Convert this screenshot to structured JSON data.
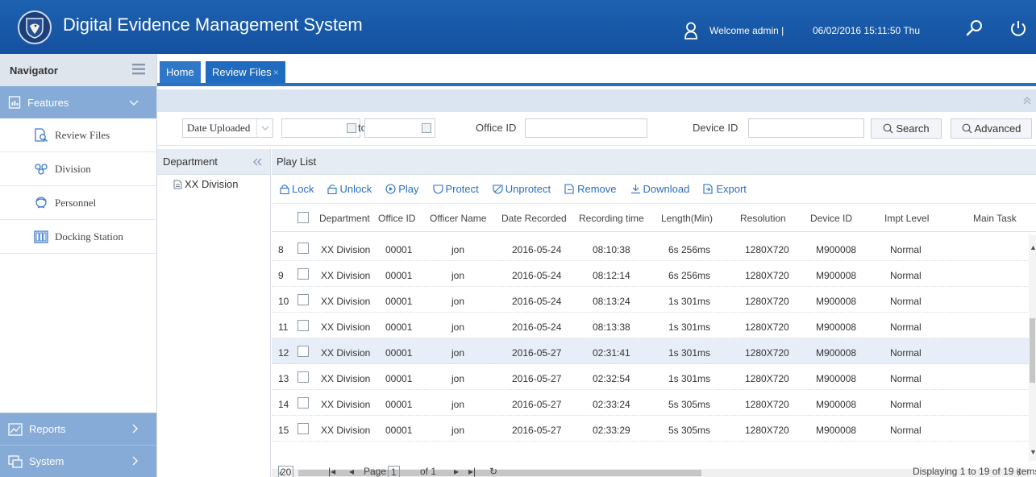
{
  "header": {
    "title": "Digital Evidence Management System",
    "welcome": "Welcome  admin |",
    "datetime": "06/02/2016 15:11:50 Thu",
    "logo_icon": "eagle-shield-icon",
    "user_icon": "user-icon",
    "search_icon": "search-icon",
    "power_icon": "power-icon"
  },
  "sidebar": {
    "navigator": "Navigator",
    "groups": [
      {
        "label": "Features",
        "icon": "features-icon"
      },
      {
        "label": "Reports",
        "icon": "reports-icon"
      },
      {
        "label": "System",
        "icon": "system-icon"
      }
    ],
    "items": [
      {
        "label": "Review Files",
        "icon": "review-files-icon"
      },
      {
        "label": "Division",
        "icon": "division-icon"
      },
      {
        "label": "Personnel",
        "icon": "personnel-icon"
      },
      {
        "label": "Docking Station",
        "icon": "docking-station-icon"
      }
    ]
  },
  "tabs": [
    {
      "label": "Home"
    },
    {
      "label": "Review Files",
      "close": "×"
    }
  ],
  "filter": {
    "date_select": "Date Uploaded",
    "to_label": "to",
    "office_id_label": "Office ID",
    "device_id_label": "Device ID",
    "search_button": "Search",
    "advanced_button": "Advanced"
  },
  "department": {
    "title": "Department",
    "node": "XX Division"
  },
  "playlist": {
    "title": "Play List",
    "toolbar": [
      "Lock",
      "Unlock",
      "Play",
      "Protect",
      "Unprotect",
      "Remove",
      "Download",
      "Export"
    ],
    "columns": [
      "Department",
      "Office ID",
      "Officer Name",
      "Date Recorded",
      "Recording time",
      "Length(Min)",
      "Resolution",
      "Device ID",
      "Impt Level",
      "Main Task"
    ],
    "rows": [
      {
        "n": "8",
        "dept": "XX Division",
        "office": "00001",
        "officer": "jon",
        "date": "2016-05-24",
        "time": "08:10:38",
        "length": "6s 256ms",
        "res": "1280X720",
        "device": "M900008",
        "level": "Normal"
      },
      {
        "n": "9",
        "dept": "XX Division",
        "office": "00001",
        "officer": "jon",
        "date": "2016-05-24",
        "time": "08:12:14",
        "length": "6s 256ms",
        "res": "1280X720",
        "device": "M900008",
        "level": "Normal"
      },
      {
        "n": "10",
        "dept": "XX Division",
        "office": "00001",
        "officer": "jon",
        "date": "2016-05-24",
        "time": "08:13:24",
        "length": "1s 301ms",
        "res": "1280X720",
        "device": "M900008",
        "level": "Normal"
      },
      {
        "n": "11",
        "dept": "XX Division",
        "office": "00001",
        "officer": "jon",
        "date": "2016-05-24",
        "time": "08:13:38",
        "length": "1s 301ms",
        "res": "1280X720",
        "device": "M900008",
        "level": "Normal"
      },
      {
        "n": "12",
        "dept": "XX Division",
        "office": "00001",
        "officer": "jon",
        "date": "2016-05-27",
        "time": "02:31:41",
        "length": "1s 301ms",
        "res": "1280X720",
        "device": "M900008",
        "level": "Normal",
        "selected": true
      },
      {
        "n": "13",
        "dept": "XX Division",
        "office": "00001",
        "officer": "jon",
        "date": "2016-05-27",
        "time": "02:32:54",
        "length": "1s 301ms",
        "res": "1280X720",
        "device": "M900008",
        "level": "Normal"
      },
      {
        "n": "14",
        "dept": "XX Division",
        "office": "00001",
        "officer": "jon",
        "date": "2016-05-27",
        "time": "02:33:24",
        "length": "5s 305ms",
        "res": "1280X720",
        "device": "M900008",
        "level": "Normal"
      },
      {
        "n": "15",
        "dept": "XX Division",
        "office": "00001",
        "officer": "jon",
        "date": "2016-05-27",
        "time": "02:33:29",
        "length": "5s 305ms",
        "res": "1280X720",
        "device": "M900008",
        "level": "Normal"
      }
    ]
  },
  "pager": {
    "page_size": "20",
    "page_label": "Page",
    "page_value": "1",
    "of_label": "of 1",
    "display_text": "Displaying 1 to 19 of 19 items"
  },
  "colors": {
    "header_blue": "#1c62b0",
    "nav_group_blue": "#86abd6",
    "tab_blue": "#2f78c8",
    "link_blue": "#2a6fc2",
    "selected_row": "#e7eef8"
  }
}
